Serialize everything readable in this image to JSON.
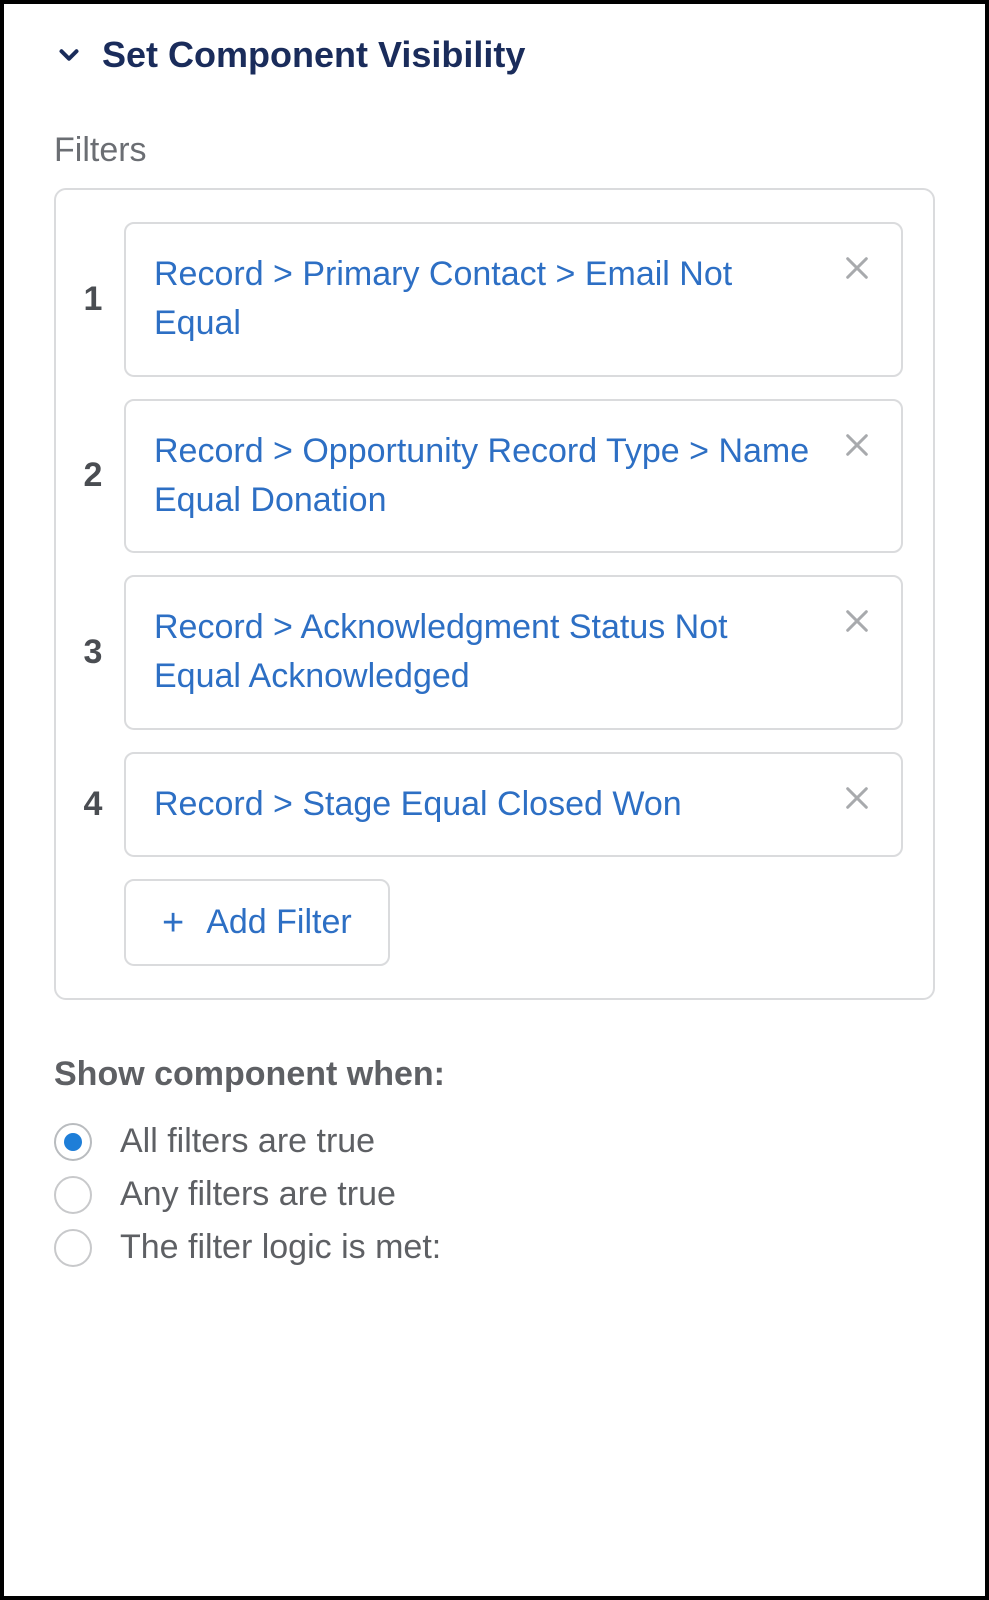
{
  "section": {
    "title": "Set Component Visibility"
  },
  "filters": {
    "label": "Filters",
    "items": [
      {
        "number": "1",
        "text": "Record > Primary Contact > Email Not Equal"
      },
      {
        "number": "2",
        "text": "Record > Opportunity Record Type > Name Equal Donation"
      },
      {
        "number": "3",
        "text": "Record > Acknowledgment Status Not Equal Acknowledged"
      },
      {
        "number": "4",
        "text": "Record > Stage Equal Closed Won"
      }
    ],
    "add_label": "Add Filter"
  },
  "showWhen": {
    "label": "Show component when:",
    "options": [
      {
        "label": "All filters are true",
        "selected": true
      },
      {
        "label": "Any filters are true",
        "selected": false
      },
      {
        "label": "The filter logic is met:",
        "selected": false
      }
    ]
  }
}
